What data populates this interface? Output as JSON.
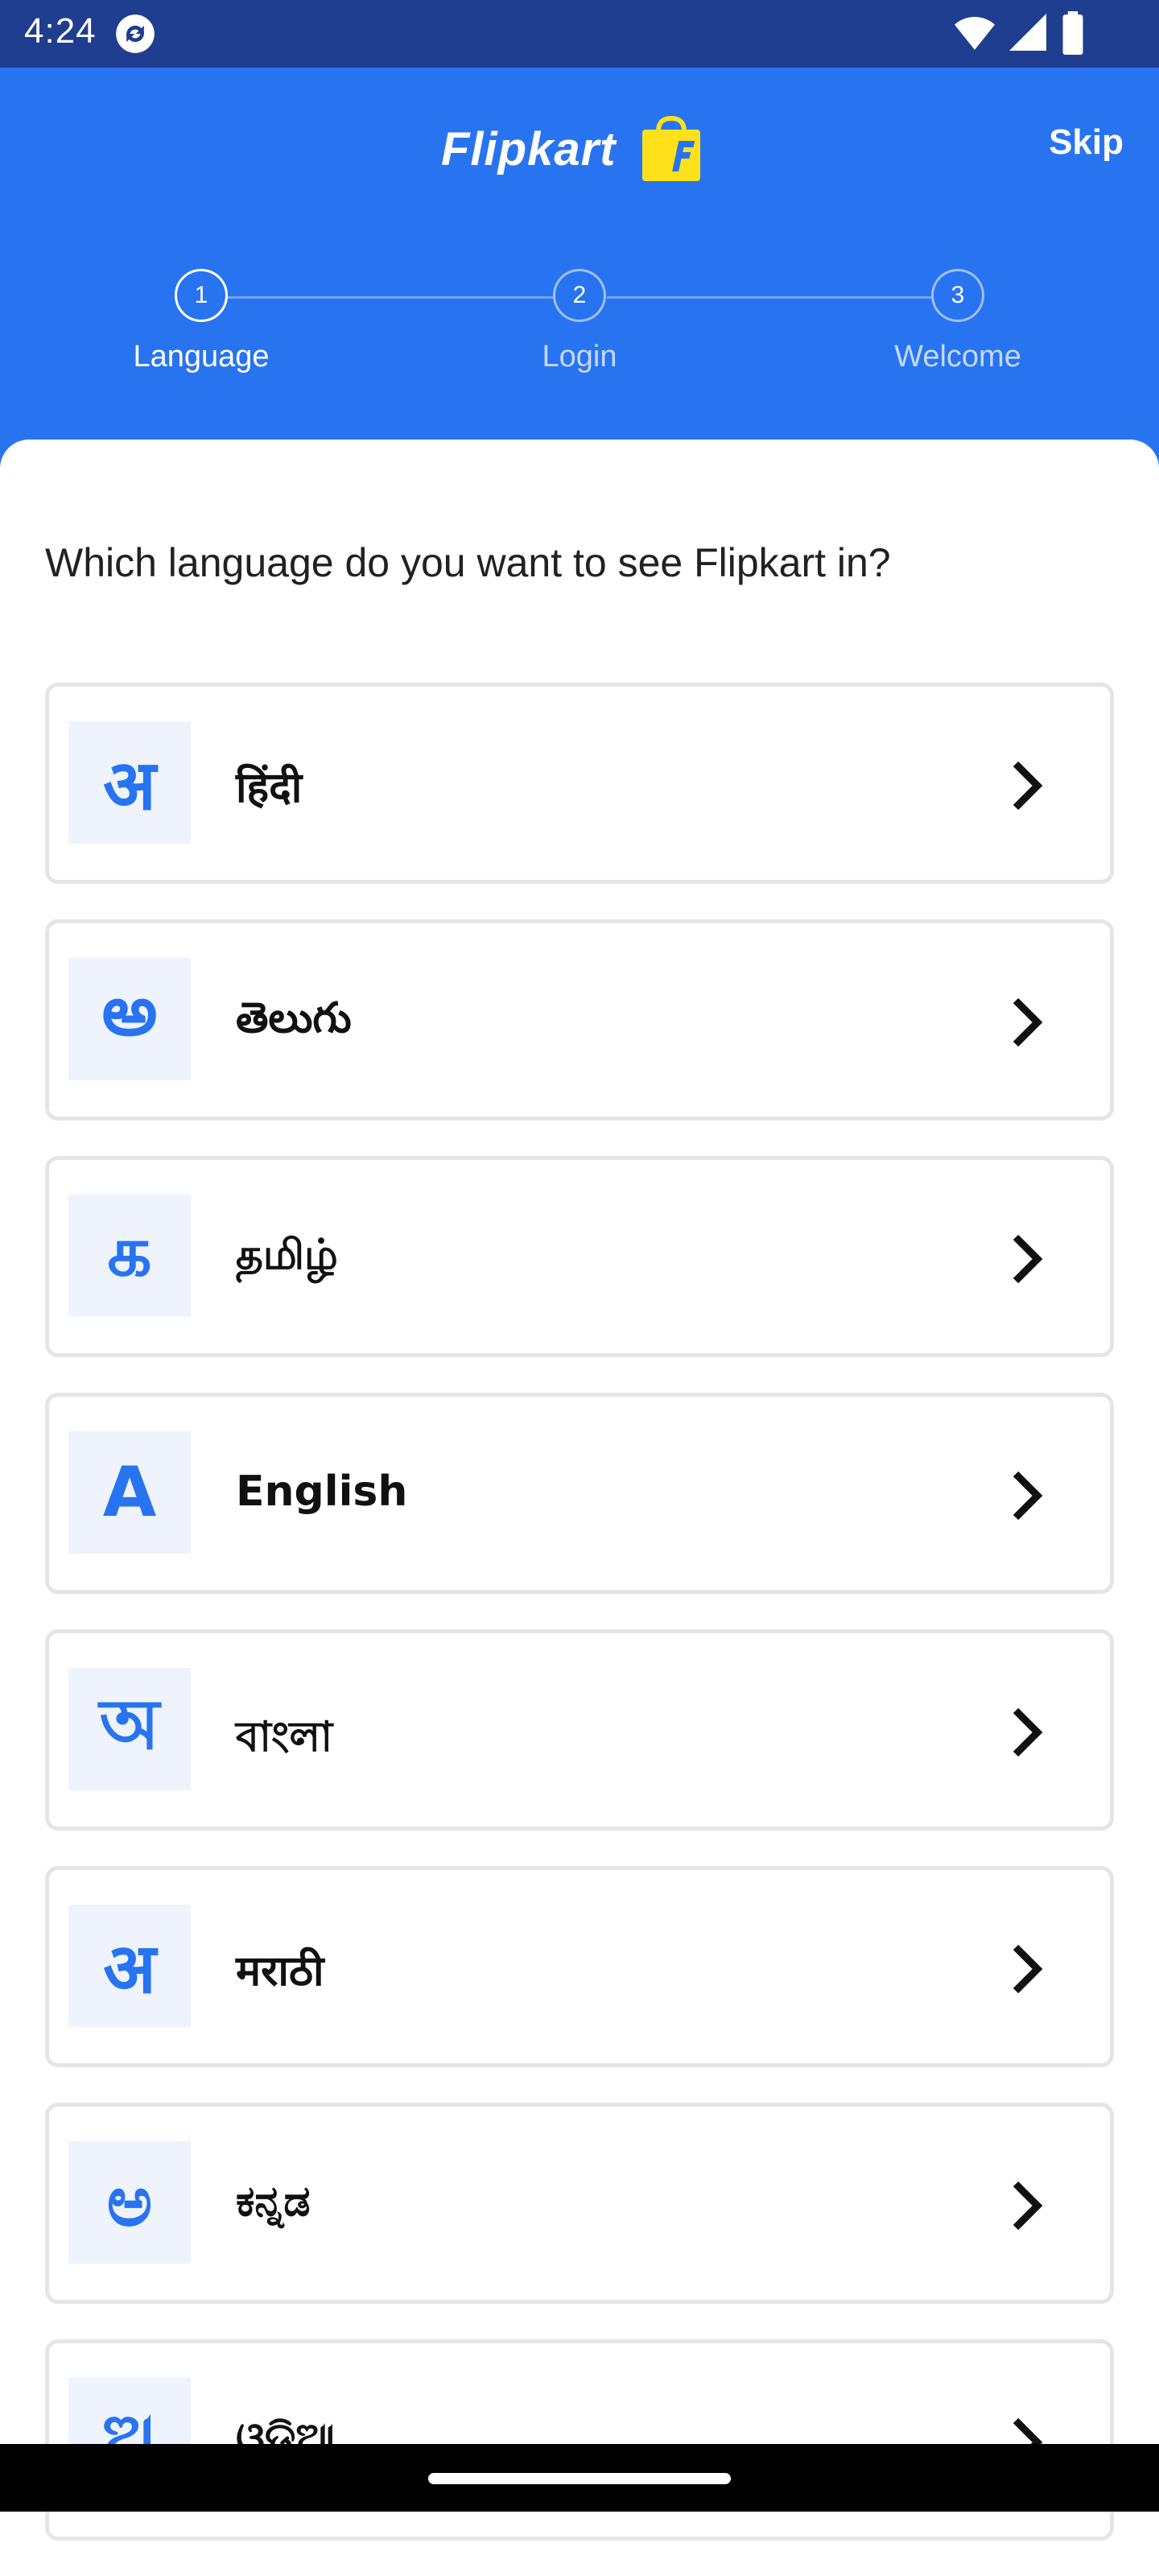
{
  "status_bar": {
    "time": "4:24"
  },
  "header": {
    "brand": "Flipkart",
    "skip_label": "Skip",
    "steps": [
      {
        "number": "1",
        "label": "Language",
        "active": true
      },
      {
        "number": "2",
        "label": "Login",
        "active": false
      },
      {
        "number": "3",
        "label": "Welcome",
        "active": false
      }
    ]
  },
  "main": {
    "question": "Which language do you want to see Flipkart in?",
    "languages": [
      {
        "glyph": "अ",
        "name": "हिंदी"
      },
      {
        "glyph": "అ",
        "name": "తెలుగు"
      },
      {
        "glyph": "க",
        "name": "தமிழ்"
      },
      {
        "glyph": "A",
        "name": "English"
      },
      {
        "glyph": "অ",
        "name": "বাংলা"
      },
      {
        "glyph": "अ",
        "name": "मराठी"
      },
      {
        "glyph": "ಅ",
        "name": "ಕನ್ನಡ"
      },
      {
        "glyph": "ଅ",
        "name": "ଓଡ଼ିଆ"
      }
    ]
  },
  "colors": {
    "brand_blue": "#2874f0",
    "status_bar": "#1f3e8f",
    "logo_yellow": "#ffe11b"
  },
  "icons": {
    "sync": "sync-icon",
    "wifi": "wifi-icon",
    "signal": "signal-icon",
    "battery": "battery-icon",
    "chevron": "chevron-right-icon",
    "bag": "shopping-bag-icon"
  }
}
